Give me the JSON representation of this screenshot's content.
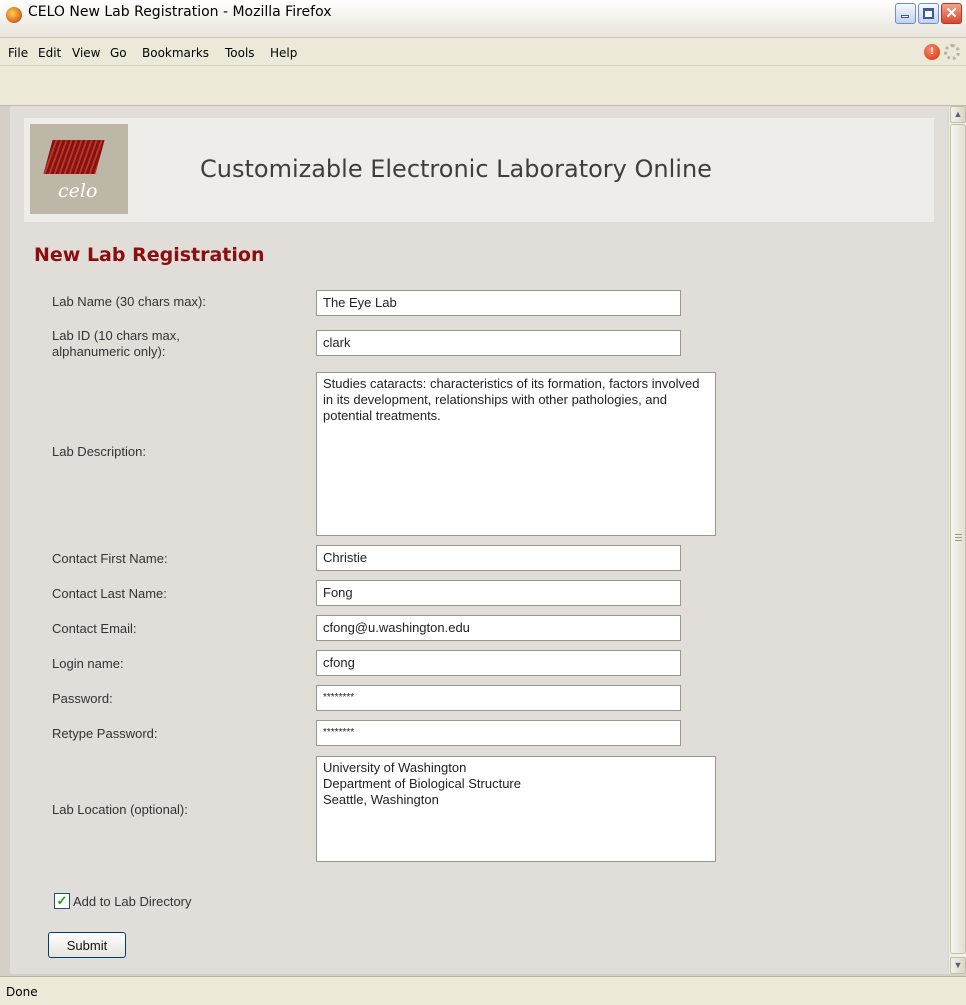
{
  "window": {
    "title": "CELO New Lab Registration - Mozilla Firefox"
  },
  "menu": [
    "File",
    "Edit",
    "View",
    "Go",
    "Bookmarks",
    "Tools",
    "Help"
  ],
  "header": {
    "logo_text": "celo",
    "site_title": "Customizable Electronic Laboratory Online"
  },
  "page_title": "New Lab Registration",
  "form": {
    "lab_name": {
      "label": "Lab Name (30 chars max):",
      "value": "The Eye Lab"
    },
    "lab_id": {
      "label": "Lab ID (10 chars max, alphanumeric only):",
      "value": "clark"
    },
    "lab_description": {
      "label": "Lab Description:",
      "value": "Studies cataracts: characteristics of its formation, factors involved in its development, relationships with other pathologies, and potential treatments."
    },
    "contact_first_name": {
      "label": "Contact First Name:",
      "value": "Christie"
    },
    "contact_last_name": {
      "label": "Contact Last Name:",
      "value": "Fong"
    },
    "contact_email": {
      "label": "Contact Email:",
      "value": "cfong@u.washington.edu"
    },
    "login_name": {
      "label": "Login name:",
      "value": "cfong"
    },
    "password": {
      "label": "Password:",
      "value": "********"
    },
    "retype_password": {
      "label": "Retype Password:",
      "value": "********"
    },
    "lab_location": {
      "label": "Lab Location (optional):",
      "value": "University of Washington\nDepartment of Biological Structure\nSeattle, Washington"
    },
    "add_to_directory": {
      "label": "Add to Lab Directory",
      "checked": true
    },
    "submit_label": "Submit"
  },
  "status": "Done",
  "colors": {
    "page_title": "#8b0d0d",
    "content_bg": "#e1ddd8"
  },
  "icons": [
    "firefox-icon",
    "minimize-icon",
    "maximize-icon",
    "close-icon",
    "stop-icon",
    "throbber-icon",
    "checkbox-checked-icon",
    "scroll-up-icon",
    "scroll-down-icon"
  ]
}
